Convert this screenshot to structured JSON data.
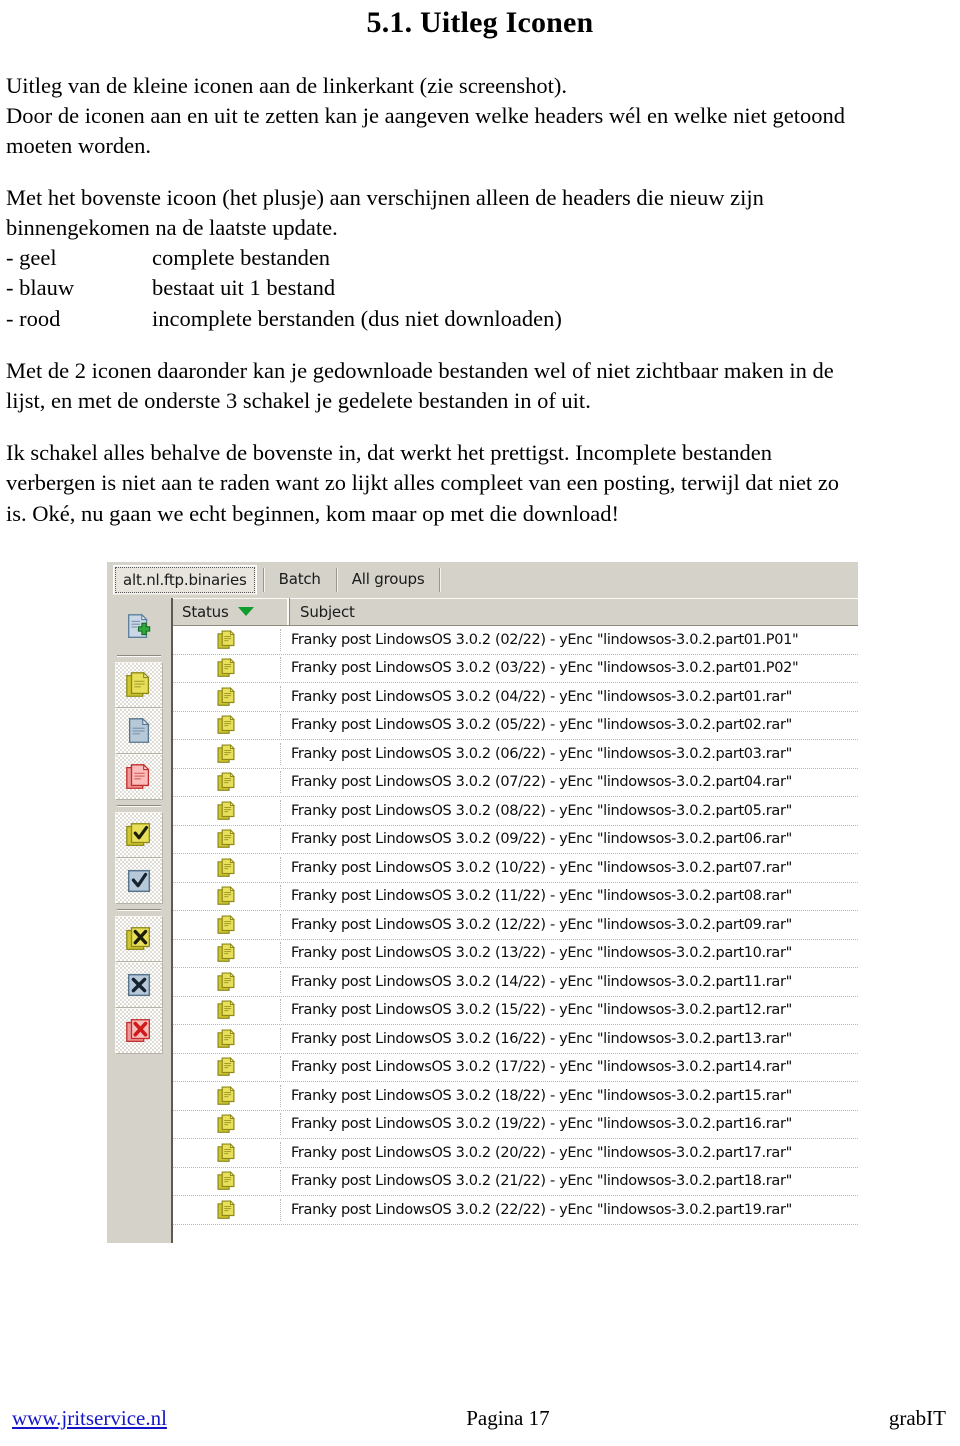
{
  "document": {
    "title": "5.1. Uitleg Iconen",
    "intro_paragraph": [
      "Uitleg van de kleine iconen aan de linkerkant (zie screenshot).",
      "Door de iconen aan en uit te zetten kan je aangeven welke headers wél en welke niet getoond",
      "moeten worden."
    ],
    "second_paragraph": [
      "Met het bovenste icoon (het plusje) aan verschijnen alleen de headers die nieuw zijn",
      "binnengekomen na de laatste update."
    ],
    "legend": [
      {
        "label": "- geel",
        "desc": "complete bestanden"
      },
      {
        "label": "- blauw",
        "desc": "bestaat uit 1 bestand"
      },
      {
        "label": "- rood",
        "desc": "incomplete berstanden  (dus niet downloaden)"
      }
    ],
    "third_paragraph": [
      "Met de 2 iconen daaronder kan je gedownloade bestanden wel of niet zichtbaar maken in de",
      "lijst, en met de onderste 3 schakel je gedelete bestanden in of uit."
    ],
    "fourth_paragraph": [
      "Ik schakel alles behalve de bovenste in, dat werkt het prettigst. Incomplete bestanden",
      "verbergen is niet aan te raden want zo lijkt alles compleet van een posting, terwijl dat niet zo",
      "is. Oké, nu gaan we echt beginnen, kom maar op met die download!"
    ]
  },
  "screenshot": {
    "tabs": [
      {
        "label": "alt.nl.ftp.binaries",
        "active": true
      },
      {
        "label": "Batch",
        "active": false
      },
      {
        "label": "All groups",
        "active": false
      }
    ],
    "icon_rail": {
      "groups": [
        [
          {
            "name": "new-headers-plus-icon",
            "color": "#7fa7c4"
          }
        ],
        [
          {
            "name": "complete-files-yellow-icon",
            "color": "#d9d23a"
          },
          {
            "name": "single-file-blue-icon",
            "color": "#9fb6cc"
          },
          {
            "name": "incomplete-files-red-icon",
            "color": "#f07a7a"
          }
        ],
        [
          {
            "name": "downloaded-files-yellow-check-icon",
            "color": "#d9d23a"
          },
          {
            "name": "downloaded-single-blue-check-icon",
            "color": "#9fb6cc"
          }
        ],
        [
          {
            "name": "deleted-files-yellow-x-icon",
            "color": "#d9d23a"
          },
          {
            "name": "deleted-single-blue-x-icon",
            "color": "#9fb6cc"
          },
          {
            "name": "deleted-incomplete-red-x-icon",
            "color": "#f07a7a"
          }
        ]
      ]
    },
    "columns": {
      "status": "Status",
      "subject": "Subject",
      "sort_indicator": "descending"
    },
    "rows": [
      {
        "status_icon": "yellow-docs-icon",
        "subject": "Franky post LindowsOS 3.0.2  (02/22) - yEnc \"lindowsos-3.0.2.part01.P01\""
      },
      {
        "status_icon": "yellow-docs-icon",
        "subject": "Franky post LindowsOS 3.0.2  (03/22) - yEnc \"lindowsos-3.0.2.part01.P02\""
      },
      {
        "status_icon": "yellow-docs-icon",
        "subject": "Franky post LindowsOS 3.0.2  (04/22) - yEnc \"lindowsos-3.0.2.part01.rar\""
      },
      {
        "status_icon": "yellow-docs-icon",
        "subject": "Franky post LindowsOS 3.0.2  (05/22) - yEnc \"lindowsos-3.0.2.part02.rar\""
      },
      {
        "status_icon": "yellow-docs-icon",
        "subject": "Franky post LindowsOS 3.0.2  (06/22) - yEnc \"lindowsos-3.0.2.part03.rar\""
      },
      {
        "status_icon": "yellow-docs-icon",
        "subject": "Franky post LindowsOS 3.0.2  (07/22) - yEnc \"lindowsos-3.0.2.part04.rar\""
      },
      {
        "status_icon": "yellow-docs-icon",
        "subject": "Franky post LindowsOS 3.0.2  (08/22) - yEnc \"lindowsos-3.0.2.part05.rar\""
      },
      {
        "status_icon": "yellow-docs-icon",
        "subject": "Franky post LindowsOS 3.0.2  (09/22) - yEnc \"lindowsos-3.0.2.part06.rar\""
      },
      {
        "status_icon": "yellow-docs-icon",
        "subject": "Franky post LindowsOS 3.0.2  (10/22) - yEnc \"lindowsos-3.0.2.part07.rar\""
      },
      {
        "status_icon": "yellow-docs-icon",
        "subject": "Franky post LindowsOS 3.0.2  (11/22) - yEnc \"lindowsos-3.0.2.part08.rar\""
      },
      {
        "status_icon": "yellow-docs-icon",
        "subject": "Franky post LindowsOS 3.0.2  (12/22) - yEnc \"lindowsos-3.0.2.part09.rar\""
      },
      {
        "status_icon": "yellow-docs-icon",
        "subject": "Franky post LindowsOS 3.0.2  (13/22) - yEnc \"lindowsos-3.0.2.part10.rar\""
      },
      {
        "status_icon": "yellow-docs-icon",
        "subject": "Franky post LindowsOS 3.0.2  (14/22) - yEnc \"lindowsos-3.0.2.part11.rar\""
      },
      {
        "status_icon": "yellow-docs-icon",
        "subject": "Franky post LindowsOS 3.0.2  (15/22) - yEnc \"lindowsos-3.0.2.part12.rar\""
      },
      {
        "status_icon": "yellow-docs-icon",
        "subject": "Franky post LindowsOS 3.0.2  (16/22) - yEnc \"lindowsos-3.0.2.part13.rar\""
      },
      {
        "status_icon": "yellow-docs-icon",
        "subject": "Franky post LindowsOS 3.0.2  (17/22) - yEnc \"lindowsos-3.0.2.part14.rar\""
      },
      {
        "status_icon": "yellow-docs-icon",
        "subject": "Franky post LindowsOS 3.0.2  (18/22) - yEnc \"lindowsos-3.0.2.part15.rar\""
      },
      {
        "status_icon": "yellow-docs-icon",
        "subject": "Franky post LindowsOS 3.0.2  (19/22) - yEnc \"lindowsos-3.0.2.part16.rar\""
      },
      {
        "status_icon": "yellow-docs-icon",
        "subject": "Franky post LindowsOS 3.0.2  (20/22) - yEnc \"lindowsos-3.0.2.part17.rar\""
      },
      {
        "status_icon": "yellow-docs-icon",
        "subject": "Franky post LindowsOS 3.0.2  (21/22) - yEnc \"lindowsos-3.0.2.part18.rar\""
      },
      {
        "status_icon": "yellow-docs-icon",
        "subject": "Franky post LindowsOS 3.0.2  (22/22) - yEnc \"lindowsos-3.0.2.part19.rar\""
      }
    ]
  },
  "footer": {
    "link": "www.jritservice.nl",
    "page": "Pagina 17",
    "brand": "grabIT"
  },
  "colors": {
    "window_face": "#d5d2ca",
    "list_background": "#ffffff",
    "sort_arrow_green": "#0f9d2f",
    "link_blue": "#1414c8",
    "icon_yellow": "#d9d23a",
    "icon_blue": "#9fb6cc",
    "icon_red": "#f07a7a",
    "icon_green_plus": "#2faa3c"
  }
}
